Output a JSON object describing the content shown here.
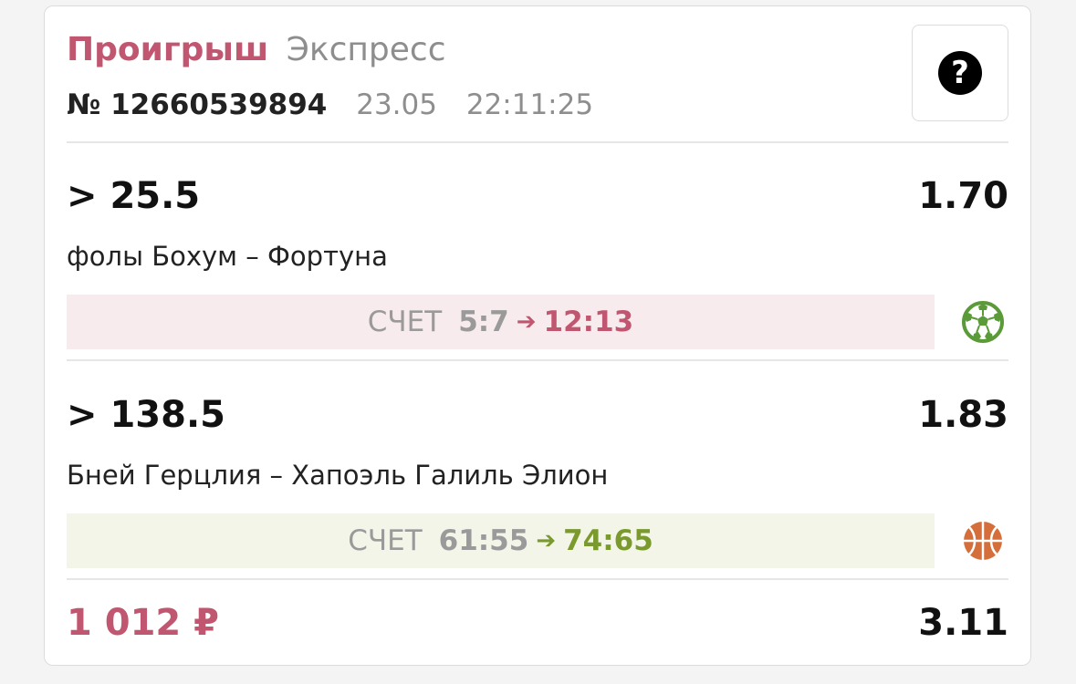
{
  "bet": {
    "status": "Проигрыш",
    "type": "Экспресс",
    "number": "№ 12660539894",
    "date": "23.05",
    "time": "22:11:25",
    "help_icon": "question-circle-icon",
    "help_glyph": "?"
  },
  "events": [
    {
      "outcome": "> 25.5",
      "odds": "1.70",
      "name": "фолы Бохум – Фортуна",
      "score_label": "СЧЕТ",
      "score_start": "5:7",
      "arrow": "➔",
      "score_end": "12:13",
      "result": "loss",
      "sport_icon": "soccer-ball-icon"
    },
    {
      "outcome": "> 138.5",
      "odds": "1.83",
      "name": "Бней Герцлия – Хапоэль Галиль Элион",
      "score_label": "СЧЕТ",
      "score_start": "61:55",
      "arrow": "➔",
      "score_end": "74:65",
      "result": "win",
      "sport_icon": "basketball-icon"
    }
  ],
  "footer": {
    "stake": "1 012 ₽",
    "total_odds": "3.11"
  },
  "colors": {
    "loss": "#c0566f",
    "win": "#7a9a2e",
    "soccer": "#5a9a38",
    "basketball": "#d46f3c"
  }
}
